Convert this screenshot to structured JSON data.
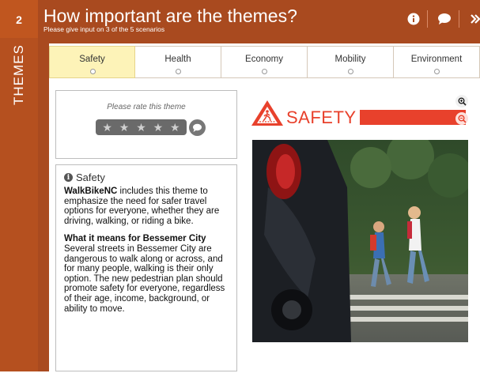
{
  "step_number": "2",
  "side_label": "THEMES",
  "header": {
    "title": "How important are the themes?",
    "subtitle": "Please give input on 3 of the 5 scenarios"
  },
  "tabs": [
    {
      "label": "Safety",
      "active": true
    },
    {
      "label": "Health",
      "active": false
    },
    {
      "label": "Economy",
      "active": false
    },
    {
      "label": "Mobility",
      "active": false
    },
    {
      "label": "Environment",
      "active": false
    }
  ],
  "rating": {
    "prompt": "Please rate this theme",
    "stars_total": 5,
    "stars_selected": 0
  },
  "info": {
    "heading": "Safety",
    "brand": "WalkBikeNC",
    "description": " includes this theme to emphasize the need for safer travel options for everyone, whether they are driving, walking, or riding a bike.",
    "subheading": "What it means for Bessemer City",
    "detail": "Several streets in Bessemer City are dangerous to walk along or across, and for many people, walking is their only option. The new pedestrian plan should promote safety for everyone, regardless of their age, income, background, or ability to move."
  },
  "image_panel": {
    "banner_text": "SAFETY"
  },
  "colors": {
    "frame": "#a94a1f",
    "accent_red": "#e8412c",
    "active_tab": "#fdf3b8"
  }
}
